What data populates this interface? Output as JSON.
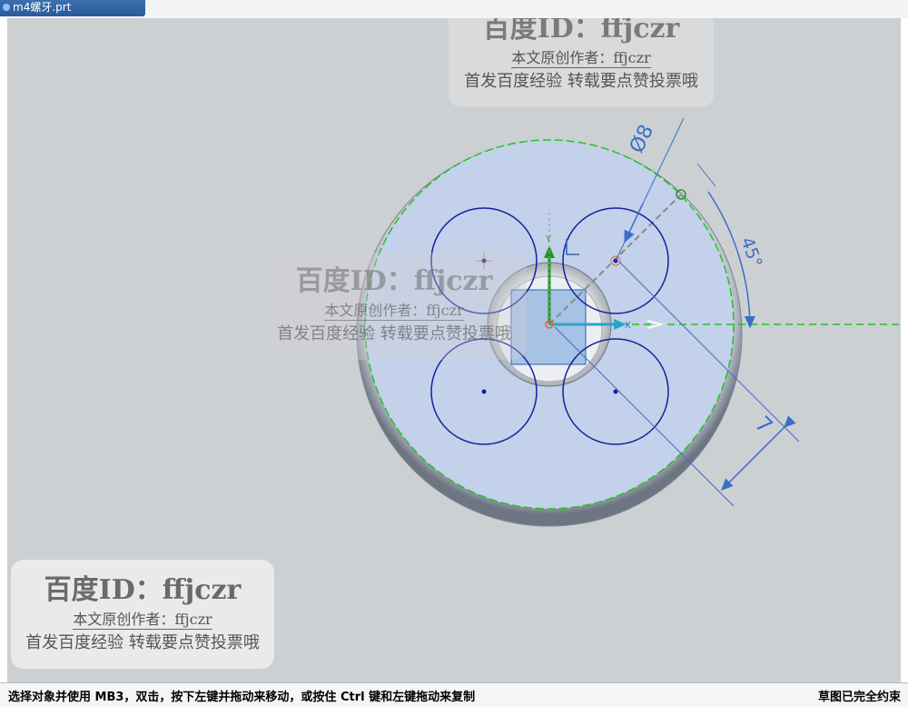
{
  "window": {
    "file_tab": "m4螺牙.prt"
  },
  "status_bar": {
    "hint": "选择对象并使用 MB3，双击，按下左键并拖动来移动，或按住 Ctrl 键和左键拖动来复制",
    "state": "草图已完全约束"
  },
  "sketch": {
    "dimension_diameter": "Ø8",
    "dimension_angle": "45°",
    "dimension_distance": "7",
    "axis_x_label": "X",
    "axis_y_label": "Y"
  },
  "watermarks": [
    {
      "id_line": "百度ID：ffjczr",
      "author_line": "本文原创作者：ffjczr",
      "notice_line": "首发百度经验 转载要点赞投票哦"
    },
    {
      "id_line": "百度ID：ffjczr",
      "author_line": "本文原创作者：ffjczr",
      "notice_line": "首发百度经验 转载要点赞投票哦"
    },
    {
      "id_line": "百度ID：ffjczr",
      "author_line": "本文原创作者：ffjczr",
      "notice_line": "首发百度经验 转载要点赞投票哦"
    }
  ],
  "colors": {
    "viewport_bg": "#cdd0d3",
    "face_fill": "#c3d1ea",
    "sketch_curve": "#1420a0",
    "constraint_green": "#22c322",
    "dimension_blue": "#3a6fc8"
  }
}
